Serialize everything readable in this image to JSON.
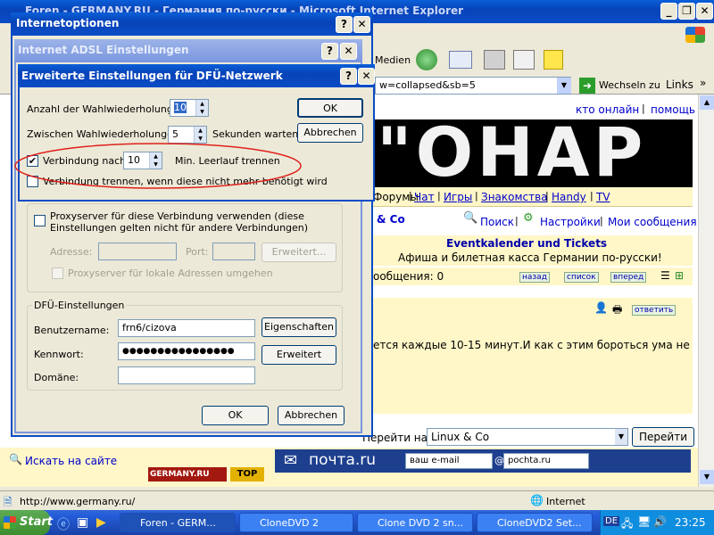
{
  "ie": {
    "title": "Foren - GERMANY.RU - Германия по-русски - Microsoft Internet Explorer",
    "toolbar_medien": "Medien",
    "address_fragment": "w=collapsed&sb=5",
    "go_label": "Wechseln zu",
    "links_label": "Links",
    "status_url": "http://www.germany.ru/",
    "status_zone": "Internet"
  },
  "web": {
    "kto_online": "кто онлайн",
    "pomosh": "помощь",
    "nav": [
      "Форумы",
      "Чат",
      "Игры",
      "Знакомства",
      "Handy",
      "TV"
    ],
    "section": "& Co",
    "poisk": "Поиск",
    "nastroiki": "Настройки",
    "moi_soobsh": "Мои сообщения",
    "event_title": "Eventkalender und Tickets",
    "event_sub": "Афиша и билетная касса Германии по-русски!",
    "soobsh_count": "ообщения: 0",
    "nazad": "назад",
    "spisok": "список",
    "vpered": "вперед",
    "otvetit": "ответить",
    "post_text": "ется каждые 10-15 минут.И как с этим бороться ума не",
    "perejti_label": "Перейти на",
    "perejti_value": "Linux & Co",
    "perejti_btn": "Перейти",
    "iskat": "Искать на сайте",
    "pochta_logo": "почта.ru",
    "email_placeholder": "ваш e-mail",
    "pochta_domain": "pochta.ru",
    "banner_text": "\"ОНАР",
    "germany_badge": "GERMANY.RU",
    "top_badge": "TOP"
  },
  "dlg_internetoptionen": {
    "title": "Internetoptionen"
  },
  "dlg_adsl": {
    "title": "Internet ADSL Einstellungen",
    "proxy_label": "Proxyserver für diese Verbindung verwenden (diese Einstellungen gelten nicht für andere Verbindungen)",
    "adresse": "Adresse:",
    "port": "Port:",
    "erweitert_proxy": "Erweitert...",
    "proxy_local": "Proxyserver für lokale Adressen umgehen",
    "dfu_group": "DFÜ-Einstellungen",
    "benutzername_label": "Benutzername:",
    "benutzername_value": "frn6/cizova",
    "eigenschaften": "Eigenschaften",
    "kennwort_label": "Kennwort:",
    "kennwort_value": "●●●●●●●●●●●●●●●●",
    "erweitert": "Erweitert",
    "domaene_label": "Domäne:",
    "domaene_value": "",
    "ok": "OK",
    "abbrechen": "Abbrechen"
  },
  "dlg_erweitert": {
    "title": "Erweiterte Einstellungen für DFÜ-Netzwerk",
    "wahlwiederholungen_label": "Anzahl der Wahlwiederholungen",
    "wahlwiederholungen_value": "10",
    "zwischen_label": "Zwischen Wahlwiederholungen",
    "zwischen_value": "5",
    "sekunden": "Sekunden warten",
    "verbindung_nach": "Verbindung nach",
    "leerlauf_value": "10",
    "leerlauf_label": "Min. Leerlauf trennen",
    "verbindung_trennen": "Verbindung trennen, wenn diese nicht mehr benötigt wird",
    "ok": "OK",
    "abbrechen": "Abbrechen"
  },
  "taskbar": {
    "start": "Start",
    "tasks": [
      "Foren - GERM...",
      "CloneDVD 2",
      "Clone DVD 2 sn...",
      "CloneDVD2 Set..."
    ],
    "lang": "DE",
    "clock": "23:25"
  },
  "colors": {
    "xp_blue": "#0a4cc6",
    "taskbar_blue": "#245edb",
    "start_green": "#3c8d2e",
    "highlight_red": "#e0201a",
    "web_blue": "#0000cc",
    "web_yellow": "#fff7c8"
  }
}
